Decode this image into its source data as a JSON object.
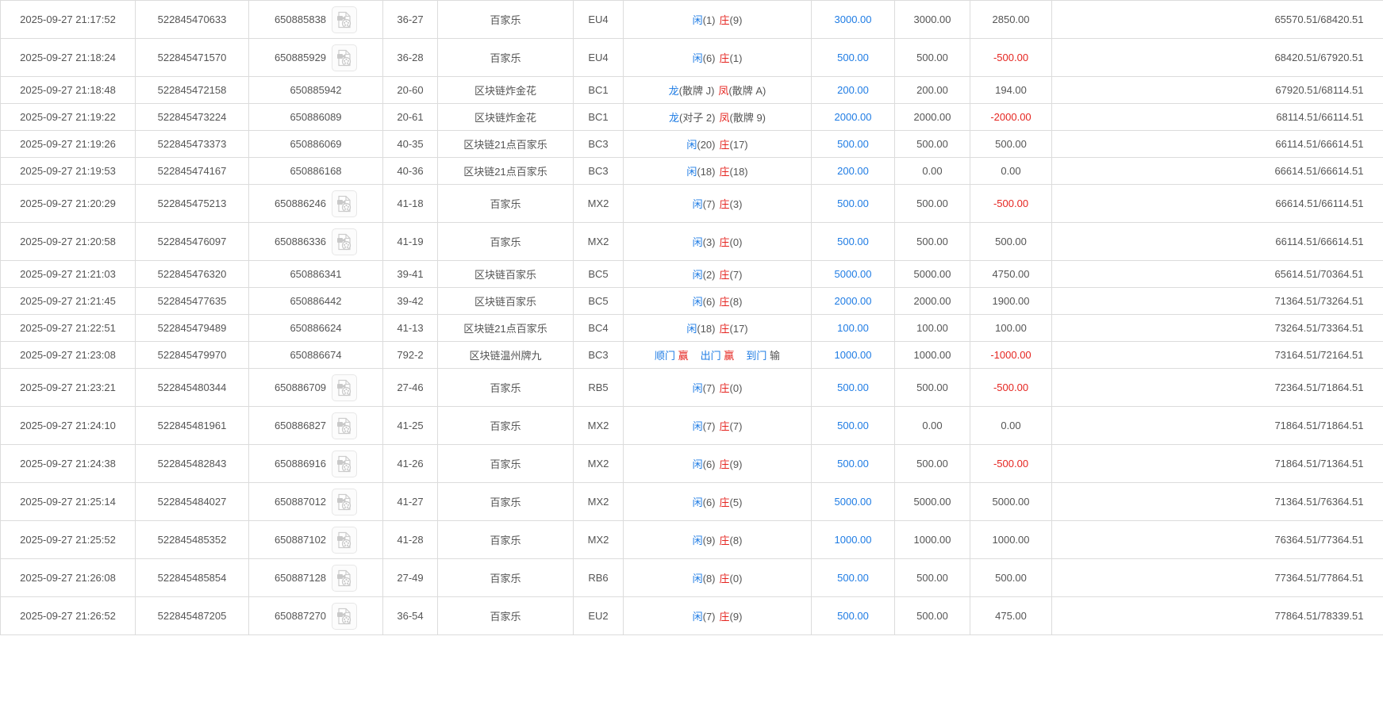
{
  "colors": {
    "accent_blue": "#1f7ce4",
    "accent_red": "#e52520",
    "text_gray": "#555555",
    "border_gray": "#dcdcdc"
  },
  "icons": {
    "video_replay": "video-file-icon"
  },
  "table": {
    "rows": [
      {
        "time": "2025-09-27 21:17:52",
        "bet_id": "522845470633",
        "round_id": "650885838",
        "video": true,
        "round": "36-27",
        "game": "百家乐",
        "table_code": "EU4",
        "result": {
          "groups": [
            [
              {
                "t": "闲",
                "c": "b"
              },
              {
                "t": "(1)",
                "c": "d"
              }
            ],
            [
              {
                "t": "庄",
                "c": "r"
              },
              {
                "t": "(9)",
                "c": "d"
              }
            ]
          ]
        },
        "bet": "3000.00",
        "valid": "3000.00",
        "win": "2850.00",
        "balance": "65570.51/68420.51"
      },
      {
        "time": "2025-09-27 21:18:24",
        "bet_id": "522845471570",
        "round_id": "650885929",
        "video": true,
        "round": "36-28",
        "game": "百家乐",
        "table_code": "EU4",
        "result": {
          "groups": [
            [
              {
                "t": "闲",
                "c": "b"
              },
              {
                "t": "(6)",
                "c": "d"
              }
            ],
            [
              {
                "t": "庄",
                "c": "r"
              },
              {
                "t": "(1)",
                "c": "d"
              }
            ]
          ]
        },
        "bet": "500.00",
        "valid": "500.00",
        "win": "-500.00",
        "balance": "68420.51/67920.51"
      },
      {
        "time": "2025-09-27 21:18:48",
        "bet_id": "522845472158",
        "round_id": "650885942",
        "video": false,
        "round": "20-60",
        "game": "区块链炸金花",
        "table_code": "BC1",
        "result": {
          "groups": [
            [
              {
                "t": "龙",
                "c": "b"
              },
              {
                "t": "(散牌 J)",
                "c": "d"
              }
            ],
            [
              {
                "t": "凤",
                "c": "r"
              },
              {
                "t": "(散牌 A)",
                "c": "d"
              }
            ]
          ]
        },
        "bet": "200.00",
        "valid": "200.00",
        "win": "194.00",
        "balance": "67920.51/68114.51"
      },
      {
        "time": "2025-09-27 21:19:22",
        "bet_id": "522845473224",
        "round_id": "650886089",
        "video": false,
        "round": "20-61",
        "game": "区块链炸金花",
        "table_code": "BC1",
        "result": {
          "groups": [
            [
              {
                "t": "龙",
                "c": "b"
              },
              {
                "t": "(对子 2)",
                "c": "d"
              }
            ],
            [
              {
                "t": "凤",
                "c": "r"
              },
              {
                "t": "(散牌 9)",
                "c": "d"
              }
            ]
          ]
        },
        "bet": "2000.00",
        "valid": "2000.00",
        "win": "-2000.00",
        "balance": "68114.51/66114.51"
      },
      {
        "time": "2025-09-27 21:19:26",
        "bet_id": "522845473373",
        "round_id": "650886069",
        "video": false,
        "round": "40-35",
        "game": "区块链21点百家乐",
        "table_code": "BC3",
        "result": {
          "groups": [
            [
              {
                "t": "闲",
                "c": "b"
              },
              {
                "t": "(20)",
                "c": "d"
              }
            ],
            [
              {
                "t": "庄",
                "c": "r"
              },
              {
                "t": "(17)",
                "c": "d"
              }
            ]
          ]
        },
        "bet": "500.00",
        "valid": "500.00",
        "win": "500.00",
        "balance": "66114.51/66614.51"
      },
      {
        "time": "2025-09-27 21:19:53",
        "bet_id": "522845474167",
        "round_id": "650886168",
        "video": false,
        "round": "40-36",
        "game": "区块链21点百家乐",
        "table_code": "BC3",
        "result": {
          "groups": [
            [
              {
                "t": "闲",
                "c": "b"
              },
              {
                "t": "(18)",
                "c": "d"
              }
            ],
            [
              {
                "t": "庄",
                "c": "r"
              },
              {
                "t": "(18)",
                "c": "d"
              }
            ]
          ]
        },
        "bet": "200.00",
        "valid": "0.00",
        "win": "0.00",
        "balance": "66614.51/66614.51"
      },
      {
        "time": "2025-09-27 21:20:29",
        "bet_id": "522845475213",
        "round_id": "650886246",
        "video": true,
        "round": "41-18",
        "game": "百家乐",
        "table_code": "MX2",
        "result": {
          "groups": [
            [
              {
                "t": "闲",
                "c": "b"
              },
              {
                "t": "(7)",
                "c": "d"
              }
            ],
            [
              {
                "t": "庄",
                "c": "r"
              },
              {
                "t": "(3)",
                "c": "d"
              }
            ]
          ]
        },
        "bet": "500.00",
        "valid": "500.00",
        "win": "-500.00",
        "balance": "66614.51/66114.51"
      },
      {
        "time": "2025-09-27 21:20:58",
        "bet_id": "522845476097",
        "round_id": "650886336",
        "video": true,
        "round": "41-19",
        "game": "百家乐",
        "table_code": "MX2",
        "result": {
          "groups": [
            [
              {
                "t": "闲",
                "c": "b"
              },
              {
                "t": "(3)",
                "c": "d"
              }
            ],
            [
              {
                "t": "庄",
                "c": "r"
              },
              {
                "t": "(0)",
                "c": "d"
              }
            ]
          ]
        },
        "bet": "500.00",
        "valid": "500.00",
        "win": "500.00",
        "balance": "66114.51/66614.51"
      },
      {
        "time": "2025-09-27 21:21:03",
        "bet_id": "522845476320",
        "round_id": "650886341",
        "video": false,
        "round": "39-41",
        "game": "区块链百家乐",
        "table_code": "BC5",
        "result": {
          "groups": [
            [
              {
                "t": "闲",
                "c": "b"
              },
              {
                "t": "(2)",
                "c": "d"
              }
            ],
            [
              {
                "t": "庄",
                "c": "r"
              },
              {
                "t": "(7)",
                "c": "d"
              }
            ]
          ]
        },
        "bet": "5000.00",
        "valid": "5000.00",
        "win": "4750.00",
        "balance": "65614.51/70364.51"
      },
      {
        "time": "2025-09-27 21:21:45",
        "bet_id": "522845477635",
        "round_id": "650886442",
        "video": false,
        "round": "39-42",
        "game": "区块链百家乐",
        "table_code": "BC5",
        "result": {
          "groups": [
            [
              {
                "t": "闲",
                "c": "b"
              },
              {
                "t": "(6)",
                "c": "d"
              }
            ],
            [
              {
                "t": "庄",
                "c": "r"
              },
              {
                "t": "(8)",
                "c": "d"
              }
            ]
          ]
        },
        "bet": "2000.00",
        "valid": "2000.00",
        "win": "1900.00",
        "balance": "71364.51/73264.51"
      },
      {
        "time": "2025-09-27 21:22:51",
        "bet_id": "522845479489",
        "round_id": "650886624",
        "video": false,
        "round": "41-13",
        "game": "区块链21点百家乐",
        "table_code": "BC4",
        "result": {
          "groups": [
            [
              {
                "t": "闲",
                "c": "b"
              },
              {
                "t": "(18)",
                "c": "d"
              }
            ],
            [
              {
                "t": "庄",
                "c": "r"
              },
              {
                "t": "(17)",
                "c": "d"
              }
            ]
          ]
        },
        "bet": "100.00",
        "valid": "100.00",
        "win": "100.00",
        "balance": "73264.51/73364.51"
      },
      {
        "time": "2025-09-27 21:23:08",
        "bet_id": "522845479970",
        "round_id": "650886674",
        "video": false,
        "round": "792-2",
        "game": "区块链温州牌九",
        "table_code": "BC3",
        "result": {
          "wide": true,
          "groups": [
            [
              {
                "t": "顺门",
                "c": "b"
              },
              {
                "t": " 赢",
                "c": "r"
              }
            ],
            [
              {
                "t": "出门",
                "c": "b"
              },
              {
                "t": " 赢",
                "c": "r"
              }
            ],
            [
              {
                "t": "到门",
                "c": "b"
              },
              {
                "t": " 输",
                "c": "d"
              }
            ]
          ]
        },
        "bet": "1000.00",
        "valid": "1000.00",
        "win": "-1000.00",
        "balance": "73164.51/72164.51"
      },
      {
        "time": "2025-09-27 21:23:21",
        "bet_id": "522845480344",
        "round_id": "650886709",
        "video": true,
        "round": "27-46",
        "game": "百家乐",
        "table_code": "RB5",
        "result": {
          "groups": [
            [
              {
                "t": "闲",
                "c": "b"
              },
              {
                "t": "(7)",
                "c": "d"
              }
            ],
            [
              {
                "t": "庄",
                "c": "r"
              },
              {
                "t": "(0)",
                "c": "d"
              }
            ]
          ]
        },
        "bet": "500.00",
        "valid": "500.00",
        "win": "-500.00",
        "balance": "72364.51/71864.51"
      },
      {
        "time": "2025-09-27 21:24:10",
        "bet_id": "522845481961",
        "round_id": "650886827",
        "video": true,
        "round": "41-25",
        "game": "百家乐",
        "table_code": "MX2",
        "result": {
          "groups": [
            [
              {
                "t": "闲",
                "c": "b"
              },
              {
                "t": "(7)",
                "c": "d"
              }
            ],
            [
              {
                "t": "庄",
                "c": "r"
              },
              {
                "t": "(7)",
                "c": "d"
              }
            ]
          ]
        },
        "bet": "500.00",
        "valid": "0.00",
        "win": "0.00",
        "balance": "71864.51/71864.51"
      },
      {
        "time": "2025-09-27 21:24:38",
        "bet_id": "522845482843",
        "round_id": "650886916",
        "video": true,
        "round": "41-26",
        "game": "百家乐",
        "table_code": "MX2",
        "result": {
          "groups": [
            [
              {
                "t": "闲",
                "c": "b"
              },
              {
                "t": "(6)",
                "c": "d"
              }
            ],
            [
              {
                "t": "庄",
                "c": "r"
              },
              {
                "t": "(9)",
                "c": "d"
              }
            ]
          ]
        },
        "bet": "500.00",
        "valid": "500.00",
        "win": "-500.00",
        "balance": "71864.51/71364.51"
      },
      {
        "time": "2025-09-27 21:25:14",
        "bet_id": "522845484027",
        "round_id": "650887012",
        "video": true,
        "round": "41-27",
        "game": "百家乐",
        "table_code": "MX2",
        "result": {
          "groups": [
            [
              {
                "t": "闲",
                "c": "b"
              },
              {
                "t": "(6)",
                "c": "d"
              }
            ],
            [
              {
                "t": "庄",
                "c": "r"
              },
              {
                "t": "(5)",
                "c": "d"
              }
            ]
          ]
        },
        "bet": "5000.00",
        "valid": "5000.00",
        "win": "5000.00",
        "balance": "71364.51/76364.51"
      },
      {
        "time": "2025-09-27 21:25:52",
        "bet_id": "522845485352",
        "round_id": "650887102",
        "video": true,
        "round": "41-28",
        "game": "百家乐",
        "table_code": "MX2",
        "result": {
          "groups": [
            [
              {
                "t": "闲",
                "c": "b"
              },
              {
                "t": "(9)",
                "c": "d"
              }
            ],
            [
              {
                "t": "庄",
                "c": "r"
              },
              {
                "t": "(8)",
                "c": "d"
              }
            ]
          ]
        },
        "bet": "1000.00",
        "valid": "1000.00",
        "win": "1000.00",
        "balance": "76364.51/77364.51"
      },
      {
        "time": "2025-09-27 21:26:08",
        "bet_id": "522845485854",
        "round_id": "650887128",
        "video": true,
        "round": "27-49",
        "game": "百家乐",
        "table_code": "RB6",
        "result": {
          "groups": [
            [
              {
                "t": "闲",
                "c": "b"
              },
              {
                "t": "(8)",
                "c": "d"
              }
            ],
            [
              {
                "t": "庄",
                "c": "r"
              },
              {
                "t": "(0)",
                "c": "d"
              }
            ]
          ]
        },
        "bet": "500.00",
        "valid": "500.00",
        "win": "500.00",
        "balance": "77364.51/77864.51"
      },
      {
        "time": "2025-09-27 21:26:52",
        "bet_id": "522845487205",
        "round_id": "650887270",
        "video": true,
        "round": "36-54",
        "game": "百家乐",
        "table_code": "EU2",
        "result": {
          "groups": [
            [
              {
                "t": "闲",
                "c": "b"
              },
              {
                "t": "(7)",
                "c": "d"
              }
            ],
            [
              {
                "t": "庄",
                "c": "r"
              },
              {
                "t": "(9)",
                "c": "d"
              }
            ]
          ]
        },
        "bet": "500.00",
        "valid": "500.00",
        "win": "475.00",
        "balance": "77864.51/78339.51"
      }
    ]
  }
}
